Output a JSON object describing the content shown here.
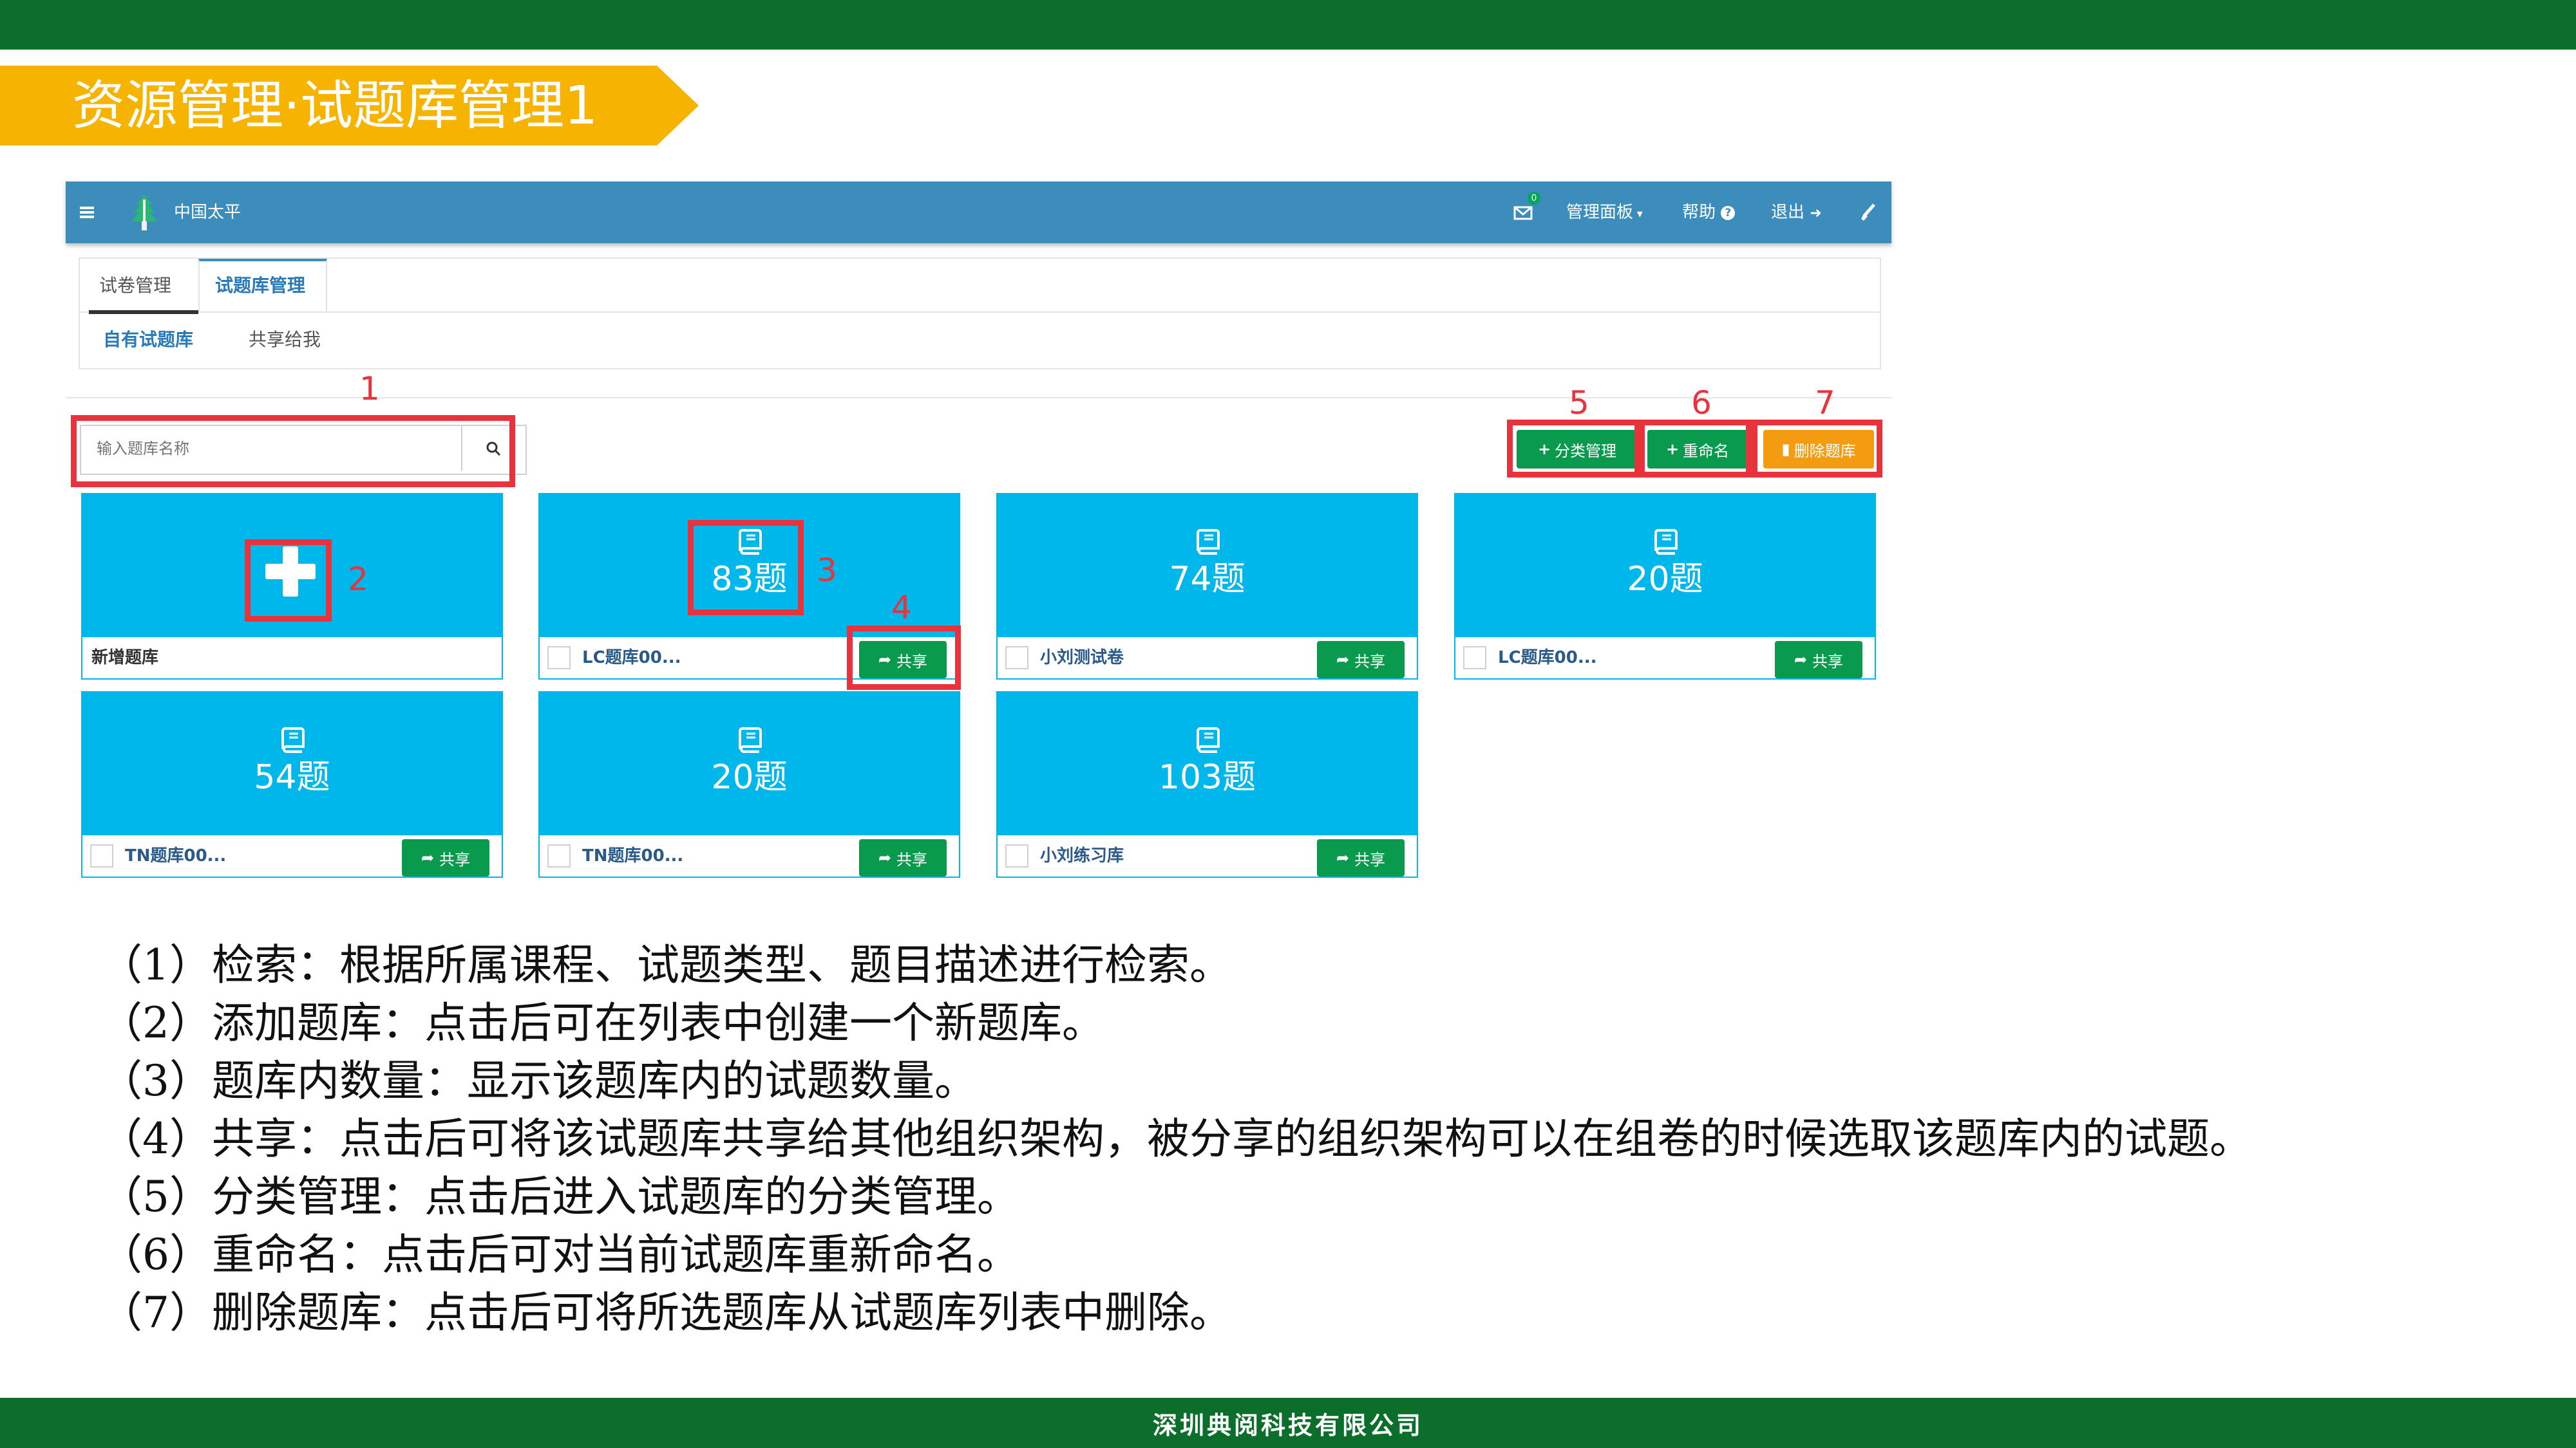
{
  "slide": {
    "title": "资源管理·试题库管理1",
    "footer": "深圳典阅科技有限公司",
    "colors": {
      "top_bar": "#0b6e2a",
      "banner": "#f6b400",
      "annotation": "#e8323c"
    }
  },
  "app": {
    "brand": "中国太平",
    "nav": {
      "mail_badge": "0",
      "dashboard": "管理面板",
      "help": "帮助",
      "logout": "退出"
    },
    "tabs": [
      "试卷管理",
      "试题库管理"
    ],
    "subtabs": [
      "自有试题库",
      "共享给我"
    ],
    "search": {
      "placeholder": "输入题库名称"
    },
    "toolbar": {
      "category": "分类管理",
      "rename": "重命名",
      "delete": "删除题库"
    },
    "new_bank_label": "新增题库",
    "share_label": "共享",
    "banks": [
      {
        "count": "83题",
        "name": "LC题库00..."
      },
      {
        "count": "74题",
        "name": "小刘测试卷"
      },
      {
        "count": "20题",
        "name": "LC题库00..."
      },
      {
        "count": "54题",
        "name": "TN题库00..."
      },
      {
        "count": "20题",
        "name": "TN题库00..."
      },
      {
        "count": "103题",
        "name": "小刘练习库"
      }
    ],
    "colors": {
      "navbar": "#3c8dbc",
      "card": "#00b7eb",
      "green_button": "#0a9a4e",
      "orange_button": "#f39c12"
    }
  },
  "annotations": [
    "1",
    "2",
    "3",
    "4",
    "5",
    "6",
    "7"
  ],
  "descriptions": [
    "（1）检索：根据所属课程、试题类型、题目描述进行检索。",
    "（2）添加题库：点击后可在列表中创建一个新题库。",
    "（3）题库内数量：显示该题库内的试题数量。",
    "（4）共享：点击后可将该试题库共享给其他组织架构，被分享的组织架构可以在组卷的时候选取该题库内的试题。",
    "（5）分类管理：点击后进入试题库的分类管理。",
    "（6）重命名：点击后可对当前试题库重新命名。",
    "（7）删除题库：点击后可将所选题库从试题库列表中删除。"
  ]
}
